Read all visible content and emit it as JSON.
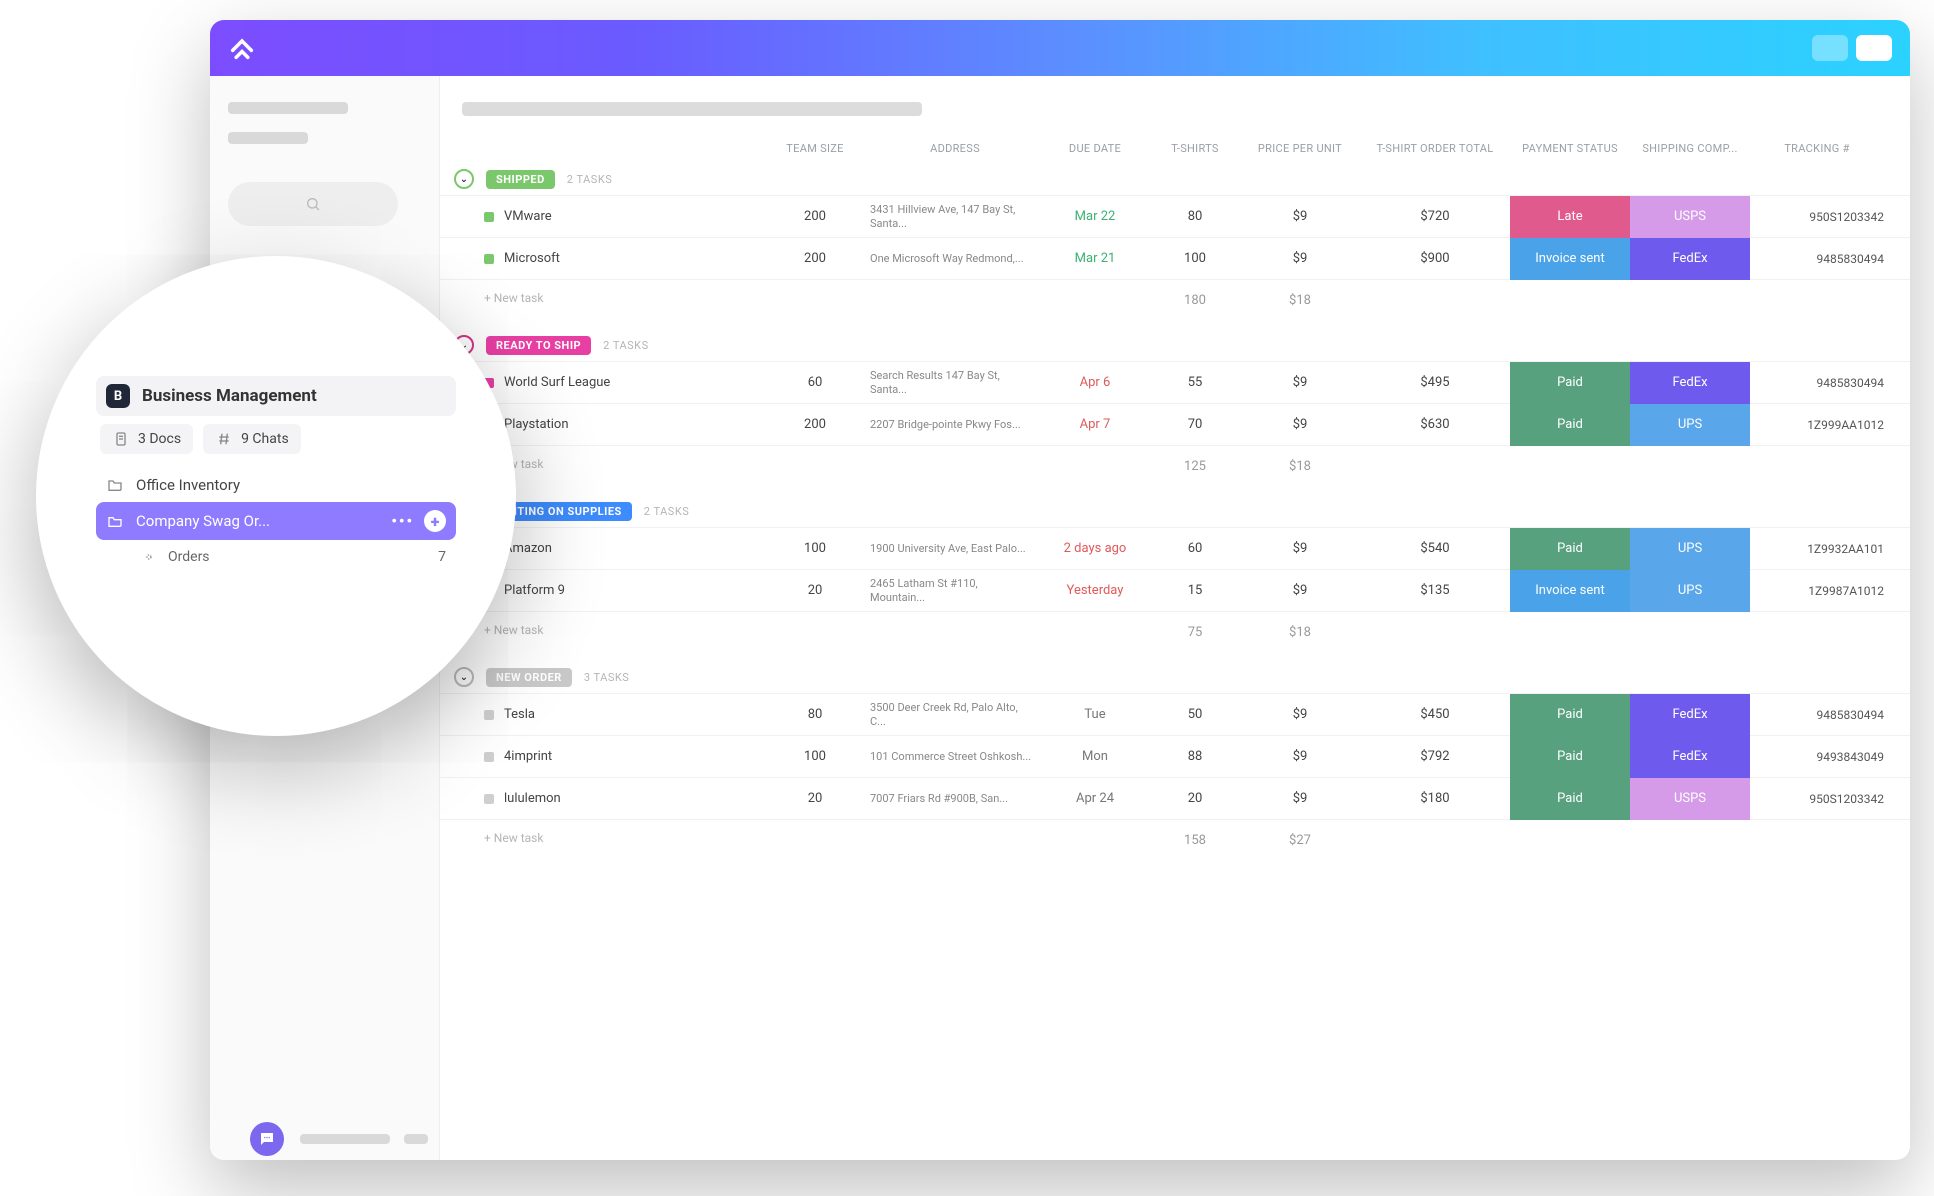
{
  "columns": [
    "TEAM SIZE",
    "ADDRESS",
    "DUE DATE",
    "T-SHIRTS",
    "PRICE PER UNIT",
    "T-SHIRT ORDER TOTAL",
    "PAYMENT STATUS",
    "SHIPPING COMP...",
    "TRACKING #"
  ],
  "new_task_label": "+ New task",
  "groups": [
    {
      "id": "shipped",
      "label": "SHIPPED",
      "count_label": "2 TASKS",
      "pill": "status-shipped",
      "circle": "",
      "sq": "green",
      "rows": [
        {
          "name": "VMware",
          "team": "200",
          "addr": "3431 Hillview Ave, 147 Bay St, Santa...",
          "due": "Mar 22",
          "due_cls": "due-green",
          "ts": "80",
          "ppu": "$9",
          "tot": "$720",
          "pay": "Late",
          "pay_cls": "late",
          "ship": "USPS",
          "ship_cls": "usps",
          "track": "950S1203342"
        },
        {
          "name": "Microsoft",
          "team": "200",
          "addr": "One Microsoft Way Redmond,...",
          "due": "Mar 21",
          "due_cls": "due-green",
          "ts": "100",
          "ppu": "$9",
          "tot": "$900",
          "pay": "Invoice sent",
          "pay_cls": "invoice",
          "ship": "FedEx",
          "ship_cls": "fedex",
          "track": "9485830494"
        }
      ],
      "footer": {
        "ts": "180",
        "ppu": "$18"
      }
    },
    {
      "id": "ready",
      "label": "READY TO SHIP",
      "count_label": "2 TASKS",
      "pill": "status-ready",
      "circle": "pink",
      "sq": "pink",
      "rows": [
        {
          "name": "World Surf League",
          "team": "60",
          "addr": "Search Results 147 Bay St, Santa...",
          "due": "Apr 6",
          "due_cls": "due-red",
          "ts": "55",
          "ppu": "$9",
          "tot": "$495",
          "pay": "Paid",
          "pay_cls": "paid",
          "ship": "FedEx",
          "ship_cls": "fedex",
          "track": "9485830494"
        },
        {
          "name": "Playstation",
          "team": "200",
          "addr": "2207 Bridge-pointe Pkwy Fos...",
          "due": "Apr 7",
          "due_cls": "due-red",
          "ts": "70",
          "ppu": "$9",
          "tot": "$630",
          "pay": "Paid",
          "pay_cls": "paid",
          "ship": "UPS",
          "ship_cls": "ups",
          "track": "1Z999AA1012"
        }
      ],
      "footer": {
        "ts": "125",
        "ppu": "$18"
      }
    },
    {
      "id": "waiting",
      "label": "WAITING ON SUPPLIES",
      "count_label": "2 TASKS",
      "pill": "status-wait",
      "circle": "blue",
      "sq": "blue",
      "rows": [
        {
          "name": "Amazon",
          "team": "100",
          "addr": "1900 University Ave, East Palo...",
          "due": "2 days ago",
          "due_cls": "due-red",
          "ts": "60",
          "ppu": "$9",
          "tot": "$540",
          "pay": "Paid",
          "pay_cls": "paid",
          "ship": "UPS",
          "ship_cls": "ups",
          "track": "1Z9932AA101"
        },
        {
          "name": "Platform 9",
          "team": "20",
          "addr": "2465 Latham St #110, Mountain...",
          "due": "Yesterday",
          "due_cls": "due-red",
          "ts": "15",
          "ppu": "$9",
          "tot": "$135",
          "pay": "Invoice sent",
          "pay_cls": "invoice",
          "ship": "UPS",
          "ship_cls": "ups",
          "track": "1Z9987A1012"
        }
      ],
      "footer": {
        "ts": "75",
        "ppu": "$18"
      }
    },
    {
      "id": "new",
      "label": "NEW ORDER",
      "count_label": "3 TASKS",
      "pill": "status-new",
      "circle": "gray",
      "sq": "gray",
      "rows": [
        {
          "name": "Tesla",
          "team": "80",
          "addr": "3500 Deer Creek Rd, Palo Alto, C...",
          "due": "Tue",
          "due_cls": "due-gray",
          "ts": "50",
          "ppu": "$9",
          "tot": "$450",
          "pay": "Paid",
          "pay_cls": "paid",
          "ship": "FedEx",
          "ship_cls": "fedex",
          "track": "9485830494"
        },
        {
          "name": "4imprint",
          "team": "100",
          "addr": "101 Commerce Street Oshkosh...",
          "due": "Mon",
          "due_cls": "due-gray",
          "ts": "88",
          "ppu": "$9",
          "tot": "$792",
          "pay": "Paid",
          "pay_cls": "paid",
          "ship": "FedEx",
          "ship_cls": "fedex",
          "track": "9493843049"
        },
        {
          "name": "lululemon",
          "team": "20",
          "addr": "7007 Friars Rd #900B, San...",
          "due": "Apr 24",
          "due_cls": "due-gray",
          "ts": "20",
          "ppu": "$9",
          "tot": "$180",
          "pay": "Paid",
          "pay_cls": "paid",
          "ship": "USPS",
          "ship_cls": "usps",
          "track": "950S1203342"
        }
      ],
      "footer": {
        "ts": "158",
        "ppu": "$27"
      }
    }
  ],
  "zoom": {
    "badge": "B",
    "title": "Business Management",
    "docs": "3 Docs",
    "chats": "9 Chats",
    "item1": "Office Inventory",
    "active": "Company Swag Or...",
    "sub": "Orders",
    "sub_count": "7"
  }
}
